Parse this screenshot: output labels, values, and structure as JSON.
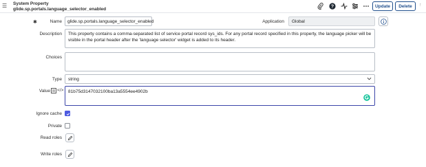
{
  "header": {
    "record_type": "System Property",
    "record_name": "glide.sp.portals.language_selector_enabled",
    "update_label": "Update",
    "delete_label": "Delete",
    "icons": [
      "menu-icon",
      "paperclip-icon",
      "help-icon",
      "activity-icon",
      "settings-sliders-icon",
      "more-icon",
      "up-arrow-icon"
    ]
  },
  "form": {
    "name_label": "Name",
    "name_value": "glide.sp.portals.language_selector_enabled",
    "application_label": "Application",
    "application_value": "Global",
    "description_label": "Description",
    "description_value": "This property contains a comma-separated list of service portal record sys_ids. For any portal record specified in this property, the language picker will be visible in the portal header after the 'language selector' widget is added to its header.",
    "choices_label": "Choices",
    "choices_value": "",
    "type_label": "Type",
    "type_value": "string",
    "value_label": "Value",
    "value_value": "81b75d3147032100ba13a5554ee4902b",
    "ignore_cache_label": "Ignore cache",
    "ignore_cache_checked": true,
    "private_label": "Private",
    "private_checked": false,
    "read_roles_label": "Read roles",
    "write_roles_label": "Write roles"
  },
  "colors": {
    "accent": "#1f4e8c",
    "checkbox_on": "#4d5ae0",
    "grammarly": "#15c39a"
  }
}
